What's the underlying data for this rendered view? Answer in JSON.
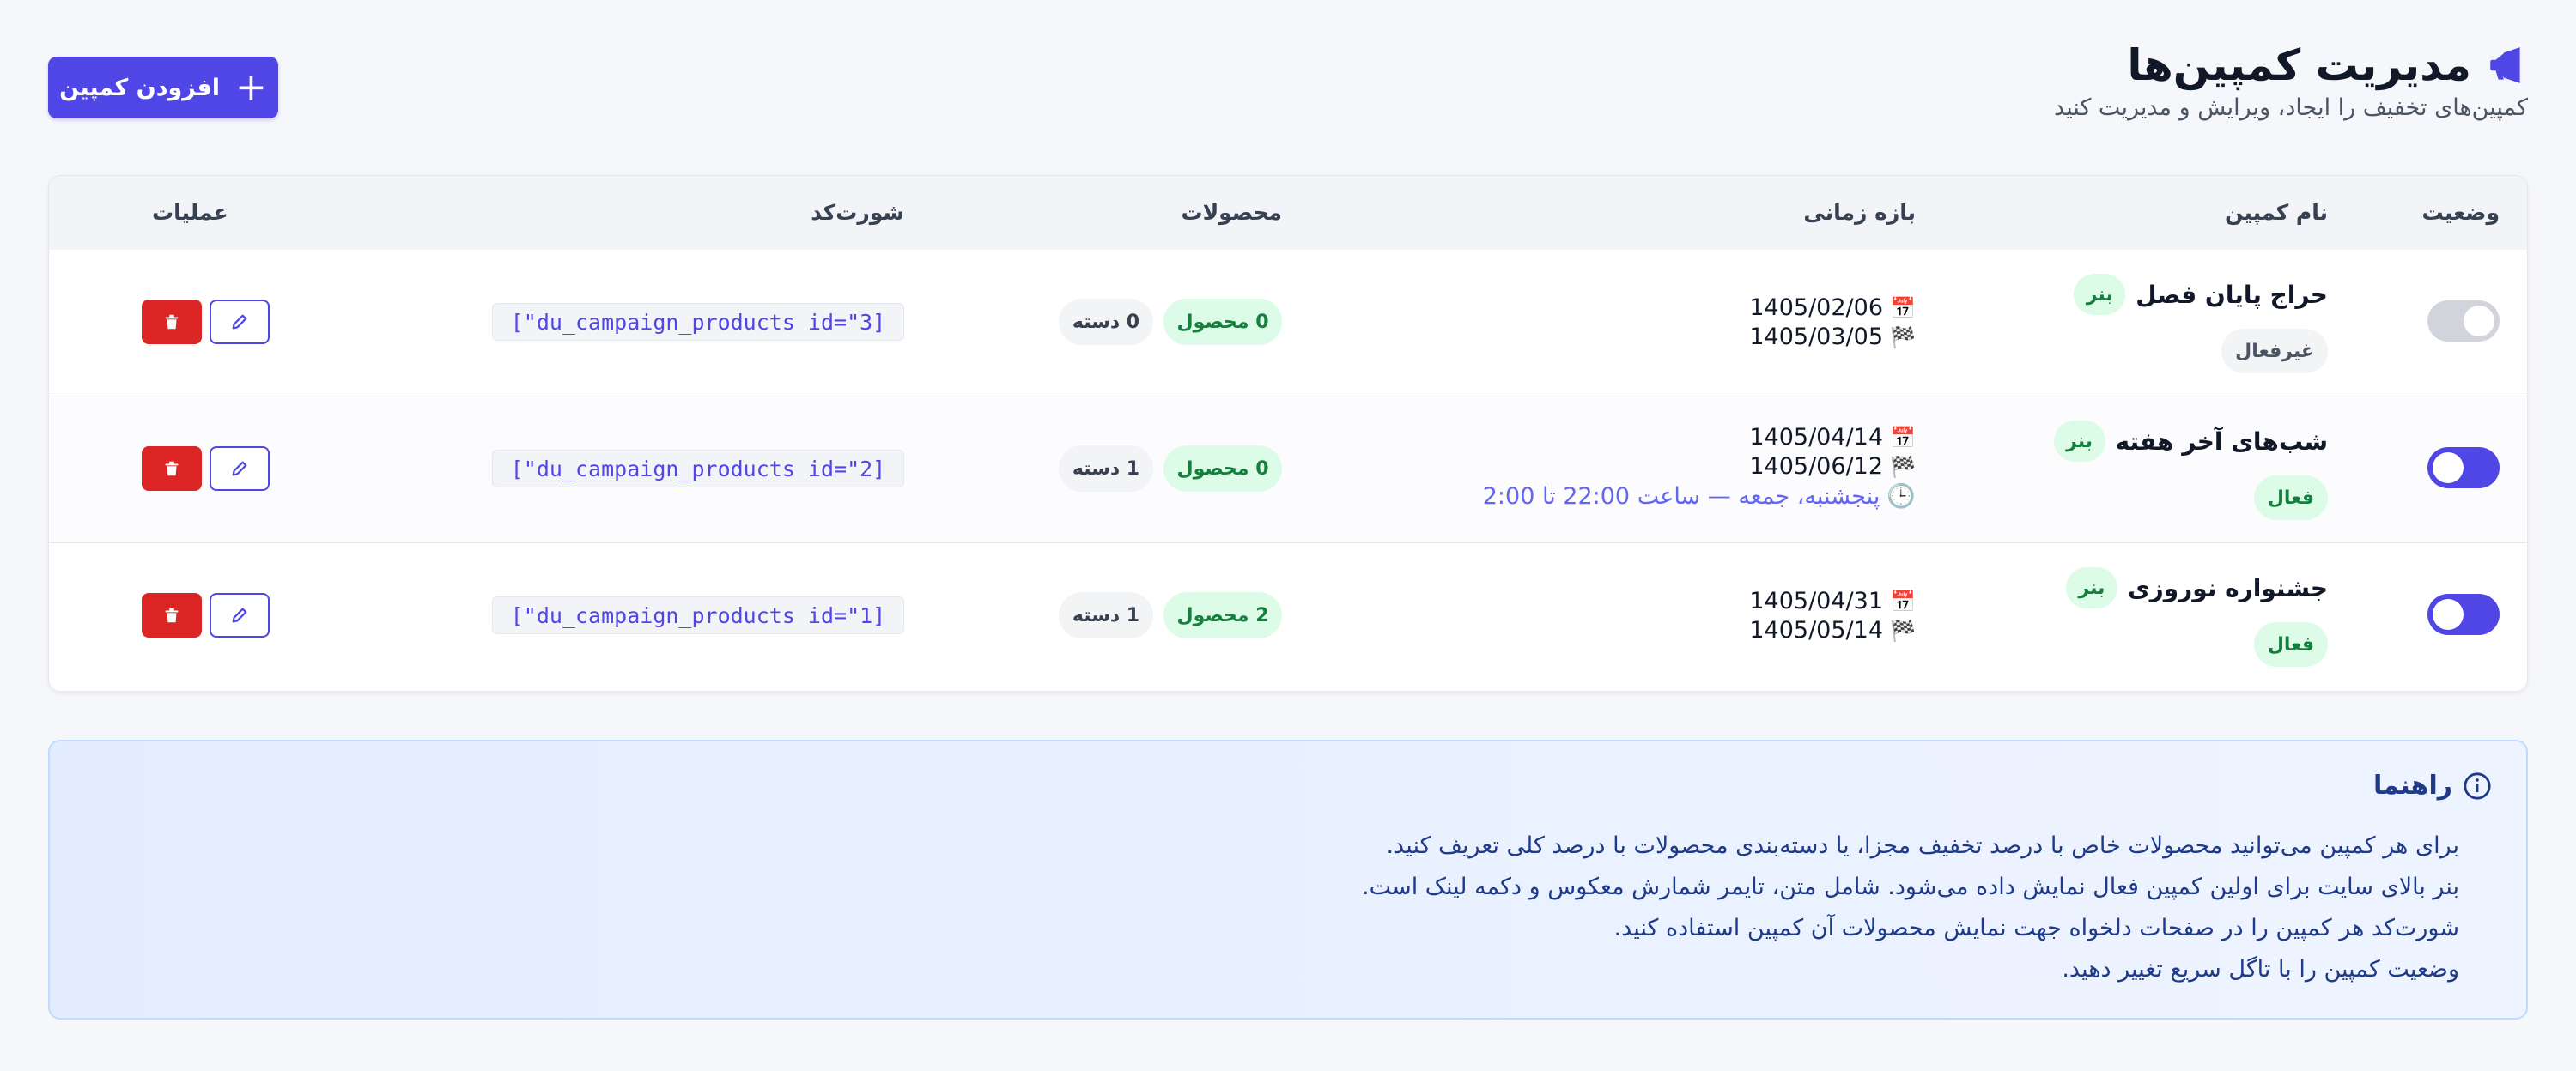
{
  "header": {
    "title": "مدیریت کمپین‌ها",
    "subtitle": "کمپین‌های تخفیف را ایجاد، ویرایش و مدیریت کنید",
    "add_button_label": "افزودن کمپین",
    "icon": "megaphone-icon"
  },
  "table": {
    "columns": [
      "وضعیت",
      "نام کمپین",
      "بازه زمانی",
      "محصولات",
      "شورت‌کد",
      "عملیات"
    ],
    "rows": [
      {
        "enabled": false,
        "name": "حراج پایان فصل",
        "banner_badge": "بنر",
        "status": "غیرفعال",
        "start_date": "1405/02/06",
        "end_date": "1405/03/05",
        "schedule": "",
        "products": "0 محصول",
        "categories": "0 دسته",
        "shortcode": "[\"du_campaign_products id=\"3]"
      },
      {
        "enabled": true,
        "name": "شب‌های آخر هفته",
        "banner_badge": "بنر",
        "status": "فعال",
        "start_date": "1405/04/14",
        "end_date": "1405/06/12",
        "schedule": "پنجشنبه، جمعه — ساعت 22:00 تا 2:00",
        "products": "0 محصول",
        "categories": "1 دسته",
        "shortcode": "[\"du_campaign_products id=\"2]"
      },
      {
        "enabled": true,
        "name": "جشنواره نوروزی",
        "banner_badge": "بنر",
        "status": "فعال",
        "start_date": "1405/04/31",
        "end_date": "1405/05/14",
        "schedule": "",
        "products": "2 محصول",
        "categories": "1 دسته",
        "shortcode": "[\"du_campaign_products id=\"1]"
      }
    ]
  },
  "guide": {
    "title": "راهنما",
    "items": [
      "برای هر کمپین می‌توانید محصولات خاص با درصد تخفیف مجزا، یا دسته‌بندی محصولات با درصد کلی تعریف کنید.",
      "بنر بالای سایت برای اولین کمپین فعال نمایش داده می‌شود. شامل متن، تایمر شمارش معکوس و دکمه لینک است.",
      "شورت‌کد هر کمپین را در صفحات دلخواه جهت نمایش محصولات آن کمپین استفاده کنید.",
      "وضعیت کمپین را با تاگل سریع تغییر دهید."
    ]
  },
  "colors": {
    "accent": "#4f46e5",
    "success_bg": "#dcfce7",
    "success_text": "#15803d",
    "danger": "#dc2626",
    "guide_text": "#1e3a8a"
  }
}
